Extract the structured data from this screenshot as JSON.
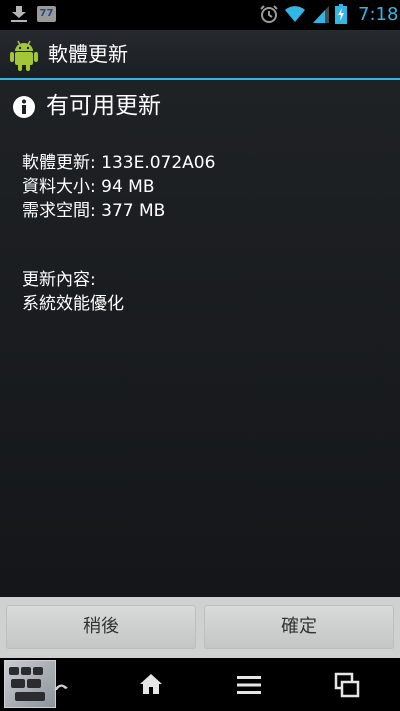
{
  "status_bar": {
    "time": "7:18",
    "badge": "77",
    "icons": [
      "download-icon",
      "notification-badge",
      "alarm-icon",
      "wifi-icon",
      "signal-icon",
      "battery-charging-icon"
    ],
    "accent_color": "#33b5e5"
  },
  "action_bar": {
    "title": "軟體更新",
    "icon": "android-robot-icon"
  },
  "dialog": {
    "title": "有可用更新",
    "icon": "info-icon",
    "software_version": "軟體更新: 133E.072A06",
    "data_size": "資料大小: 94 MB",
    "required_space": "需求空間: 377 MB",
    "content_label": "更新內容:",
    "content_text": "系統效能優化"
  },
  "buttons": {
    "later": "稍後",
    "confirm": "確定"
  },
  "nav_bar": {
    "icons": [
      "app-thumbnail",
      "back-icon",
      "home-icon",
      "menu-icon",
      "recent-apps-icon"
    ]
  }
}
